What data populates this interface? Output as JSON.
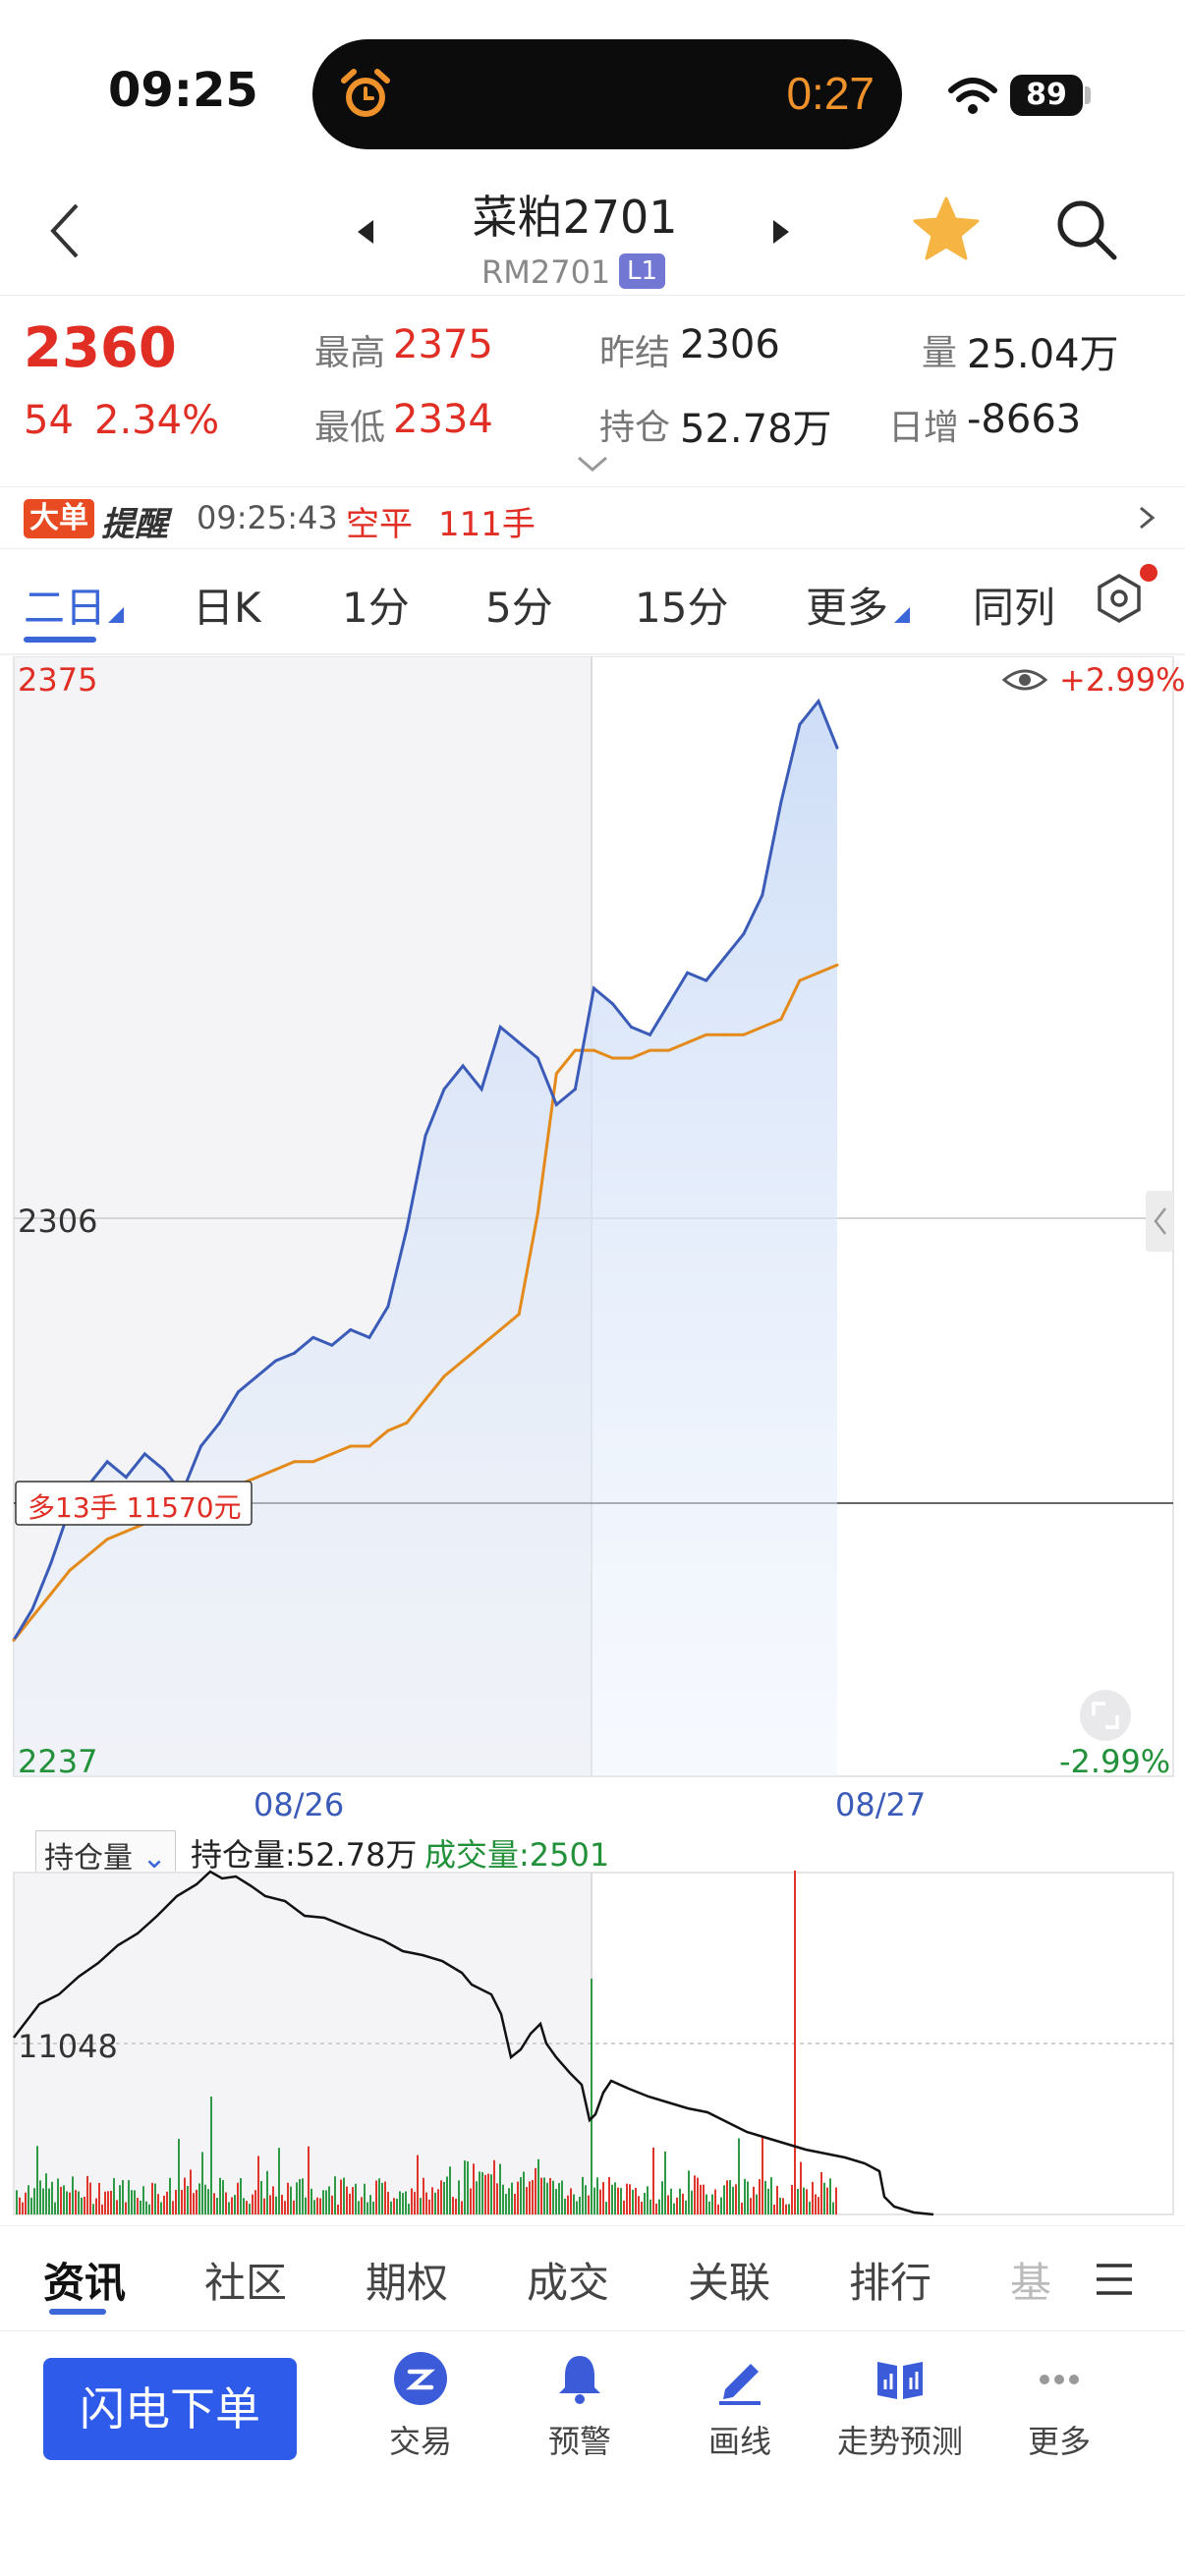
{
  "status_bar": {
    "time": "09:25",
    "timer": "0:27",
    "battery": "89"
  },
  "header": {
    "title": "菜粕2701",
    "code": "RM2701",
    "level_badge": "L1"
  },
  "quote": {
    "last": "2360",
    "change": "54",
    "change_pct": "2.34%",
    "high_label": "最高",
    "high": "2375",
    "low_label": "最低",
    "low": "2334",
    "prev_settle_label": "昨结",
    "prev_settle": "2306",
    "open_interest_label": "持仓",
    "open_interest": "52.78万",
    "volume_label": "量",
    "volume": "25.04万",
    "daily_change_label": "日增",
    "daily_change": "-8663"
  },
  "alert": {
    "badge": "大单",
    "title": "提醒",
    "time": "09:25:43",
    "type": "空平",
    "qty": "111手"
  },
  "tabs": [
    "二日",
    "日K",
    "1分",
    "5分",
    "15分",
    "更多",
    "同列"
  ],
  "chart": {
    "top_price": "2375",
    "mid_price": "2306",
    "bottom_price": "2237",
    "top_pct": "+2.99%",
    "bottom_pct": "-2.99%",
    "position_label": "多13手 11570元",
    "dates": [
      "08/26",
      "08/27"
    ],
    "oi_selector": "持仓量",
    "oi_text": "持仓量:52.78万",
    "vol_text": "成交量:2501",
    "oi_axis_value": "11048"
  },
  "chart_data": {
    "type": "line",
    "ylim": [
      2237,
      2375
    ],
    "series": [
      {
        "values": [
          2251,
          2255,
          2261,
          2268,
          2271,
          2274,
          2272,
          2275,
          2273,
          2270,
          2276,
          2279,
          2283,
          2285,
          2287,
          2288,
          2290,
          2289,
          2291,
          2290,
          2294,
          2304,
          2316,
          2322,
          2325,
          2322,
          2330,
          2328,
          2326,
          2320,
          2322,
          2335,
          2333,
          2330,
          2329,
          2333,
          2337,
          2336,
          2339,
          2342,
          2347,
          2359,
          2369,
          2372,
          2366
        ]
      },
      {
        "values": [
          2251,
          2254,
          2257,
          2260,
          2262,
          2264,
          2265,
          2266,
          2267,
          2268,
          2269,
          2270,
          2271,
          2272,
          2273,
          2274,
          2274,
          2275,
          2276,
          2276,
          2278,
          2279,
          2282,
          2285,
          2287,
          2289,
          2291,
          2293,
          2306,
          2324,
          2327,
          2327,
          2326,
          2326,
          2327,
          2327,
          2328,
          2329,
          2329,
          2329,
          2330,
          2331,
          2336,
          2337,
          2338
        ]
      }
    ]
  },
  "bottom_tabs": [
    "资讯",
    "社区",
    "期权",
    "成交",
    "关联",
    "排行",
    "基"
  ],
  "actions": {
    "flash_order": "闪电下单",
    "trade": "交易",
    "alert": "预警",
    "draw": "画线",
    "forecast": "走势预测",
    "more": "更多"
  }
}
